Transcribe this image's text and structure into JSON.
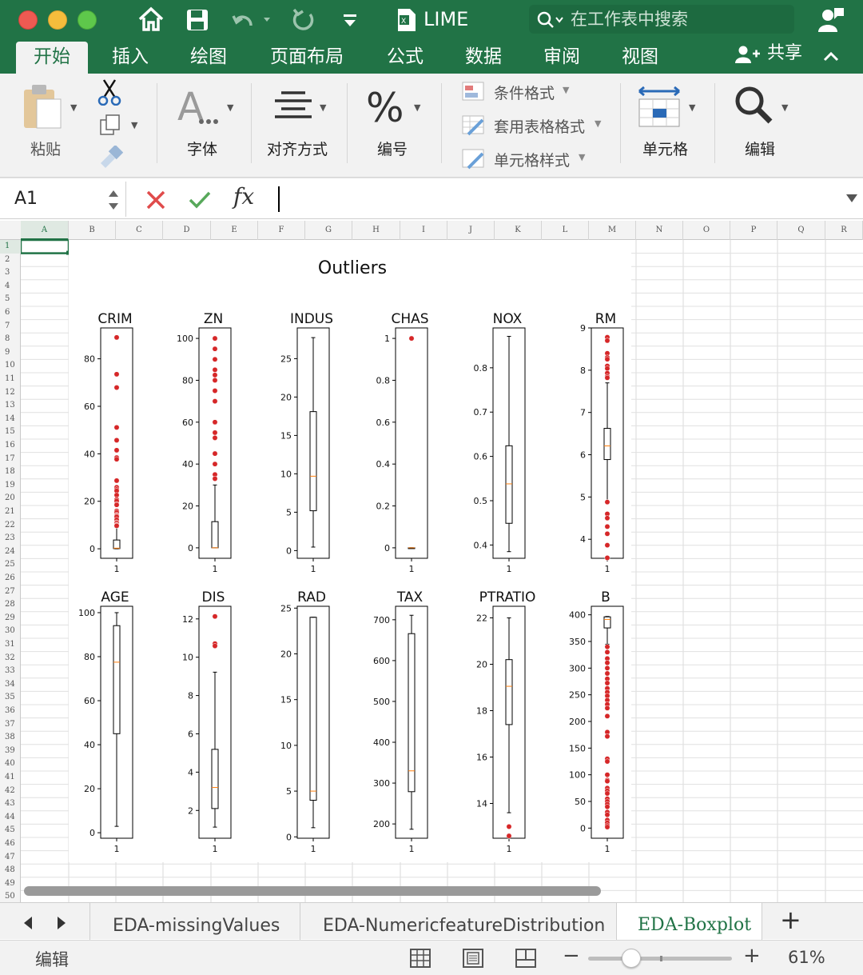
{
  "window": {
    "title": "LIME",
    "search_placeholder": "在工作表中搜索"
  },
  "ribbon_tabs": [
    "开始",
    "插入",
    "绘图",
    "页面布局",
    "公式",
    "数据",
    "审阅",
    "视图"
  ],
  "share_label": "共享",
  "ribbon": {
    "paste": "粘贴",
    "font": "字体",
    "align": "对齐方式",
    "number": "编号",
    "cond_format": "条件格式",
    "table_format": "套用表格格式",
    "cell_style": "单元格样式",
    "cells": "单元格",
    "edit": "编辑"
  },
  "formula_bar": {
    "cell_ref": "A1",
    "fx": "fx",
    "content": ""
  },
  "columns": [
    "A",
    "B",
    "C",
    "D",
    "E",
    "F",
    "G",
    "H",
    "I",
    "J",
    "K",
    "L",
    "M",
    "N",
    "O",
    "P",
    "Q",
    "R"
  ],
  "rows": [
    "1",
    "2",
    "3",
    "4",
    "5",
    "6",
    "7",
    "8",
    "9",
    "10",
    "11",
    "12",
    "13",
    "14",
    "15",
    "16",
    "17",
    "18",
    "19",
    "20",
    "21",
    "22",
    "23",
    "24",
    "25",
    "26",
    "27",
    "28",
    "29",
    "30",
    "31",
    "32",
    "33",
    "34",
    "35",
    "36",
    "37",
    "38",
    "39",
    "40",
    "41",
    "42",
    "43",
    "44",
    "45",
    "46",
    "47",
    "48",
    "49",
    "50"
  ],
  "sheet_tabs": [
    "EDA-missingValues",
    "EDA-NumericfeatureDistribution",
    "EDA-Boxplot"
  ],
  "add_sheet": "+",
  "status": {
    "mode": "编辑",
    "zoom": "61%"
  },
  "colors": {
    "excel_green": "#217346",
    "outlier": "#d62728",
    "median": "#ff7f0e"
  },
  "chart_data": {
    "type": "boxplot",
    "title": "Outliers",
    "panels": [
      {
        "name": "CRIM",
        "yticks": [
          0,
          20,
          40,
          60,
          80
        ],
        "ylim": [
          -4,
          93
        ],
        "q1": 0.08,
        "median": 0.26,
        "q3": 3.7,
        "whisker_low": 0.006,
        "whisker_high": 9.0,
        "outliers": [
          89,
          73.5,
          67.9,
          51.1,
          45.7,
          41.5,
          38.4,
          37.7,
          28.7,
          25.9,
          25.0,
          24.4,
          22.6,
          20.7,
          20.1,
          18.8,
          18.5,
          16.0,
          15.9,
          15.3,
          14.3,
          14.1,
          13.7,
          13.5,
          12.2,
          11.1,
          10.8,
          10.1,
          9.9,
          9.7
        ]
      },
      {
        "name": "ZN",
        "yticks": [
          0,
          20,
          40,
          60,
          80,
          100
        ],
        "ylim": [
          -5,
          105
        ],
        "q1": 0,
        "median": 0,
        "q3": 12.5,
        "whisker_low": 0,
        "whisker_high": 30,
        "outliers": [
          100,
          95,
          90,
          85,
          82.5,
          80,
          75,
          70,
          60,
          55,
          52.5,
          45,
          40,
          35,
          33
        ]
      },
      {
        "name": "INDUS",
        "yticks": [
          0,
          5,
          10,
          15,
          20,
          25
        ],
        "ylim": [
          -1,
          29
        ],
        "q1": 5.19,
        "median": 9.69,
        "q3": 18.1,
        "whisker_low": 0.46,
        "whisker_high": 27.74,
        "outliers": []
      },
      {
        "name": "CHAS",
        "yticks": [
          0.0,
          0.2,
          0.4,
          0.6,
          0.8,
          1.0
        ],
        "ylim": [
          -0.05,
          1.05
        ],
        "q1": 0,
        "median": 0,
        "q3": 0,
        "whisker_low": 0,
        "whisker_high": 0,
        "outliers": [
          1.0
        ]
      },
      {
        "name": "NOX",
        "yticks": [
          0.4,
          0.5,
          0.6,
          0.7,
          0.8
        ],
        "ylim": [
          0.37,
          0.89
        ],
        "q1": 0.449,
        "median": 0.538,
        "q3": 0.624,
        "whisker_low": 0.385,
        "whisker_high": 0.871,
        "outliers": []
      },
      {
        "name": "RM",
        "yticks": [
          4,
          5,
          6,
          7,
          8,
          9
        ],
        "ylim": [
          3.55,
          9.0
        ],
        "q1": 5.886,
        "median": 6.209,
        "q3": 6.624,
        "whisker_low": 4.9,
        "whisker_high": 7.7,
        "outliers": [
          8.78,
          8.7,
          8.4,
          8.3,
          8.26,
          8.1,
          8.04,
          7.93,
          7.85,
          7.82,
          4.88,
          4.6,
          4.5,
          4.3,
          4.13,
          3.86,
          3.56
        ]
      },
      {
        "name": "AGE",
        "yticks": [
          0,
          20,
          40,
          60,
          80,
          100
        ],
        "ylim": [
          -2.5,
          102.9
        ],
        "q1": 45.0,
        "median": 77.5,
        "q3": 94.1,
        "whisker_low": 2.9,
        "whisker_high": 100,
        "outliers": []
      },
      {
        "name": "DIS",
        "yticks": [
          2,
          4,
          6,
          8,
          10,
          12
        ],
        "ylim": [
          0.55,
          12.66
        ],
        "q1": 2.1,
        "median": 3.2,
        "q3": 5.19,
        "whisker_low": 1.13,
        "whisker_high": 9.22,
        "outliers": [
          12.13,
          10.71,
          10.59
        ]
      },
      {
        "name": "RAD",
        "yticks": [
          0,
          5,
          10,
          15,
          20,
          25
        ],
        "ylim": [
          -0.15,
          25.2
        ],
        "q1": 4,
        "median": 5,
        "q3": 24,
        "whisker_low": 1,
        "whisker_high": 24,
        "outliers": []
      },
      {
        "name": "TAX",
        "yticks": [
          200,
          300,
          400,
          500,
          600,
          700
        ],
        "ylim": [
          165,
          733
        ],
        "q1": 279,
        "median": 330,
        "q3": 666,
        "whisker_low": 187,
        "whisker_high": 711,
        "outliers": []
      },
      {
        "name": "PTRATIO",
        "yticks": [
          14,
          16,
          18,
          20,
          22
        ],
        "ylim": [
          12.5,
          22.5
        ],
        "q1": 17.4,
        "median": 19.05,
        "q3": 20.2,
        "whisker_low": 13.6,
        "whisker_high": 22.0,
        "outliers": [
          13.0,
          12.6
        ]
      },
      {
        "name": "B",
        "yticks": [
          0,
          50,
          100,
          150,
          200,
          250,
          300,
          350,
          400
        ],
        "ylim": [
          -19,
          416
        ],
        "q1": 375.4,
        "median": 391.4,
        "q3": 396.2,
        "whisker_low": 344.9,
        "whisker_high": 396.9,
        "outliers": [
          340,
          330,
          318,
          310,
          300,
          290,
          280,
          272,
          262,
          255,
          248,
          240,
          232,
          225,
          210,
          180,
          172,
          130,
          125,
          100,
          90,
          88,
          75,
          70,
          65,
          55,
          50,
          45,
          40,
          30,
          25,
          15,
          10,
          5,
          2
        ]
      }
    ],
    "xtick_label": "1"
  }
}
